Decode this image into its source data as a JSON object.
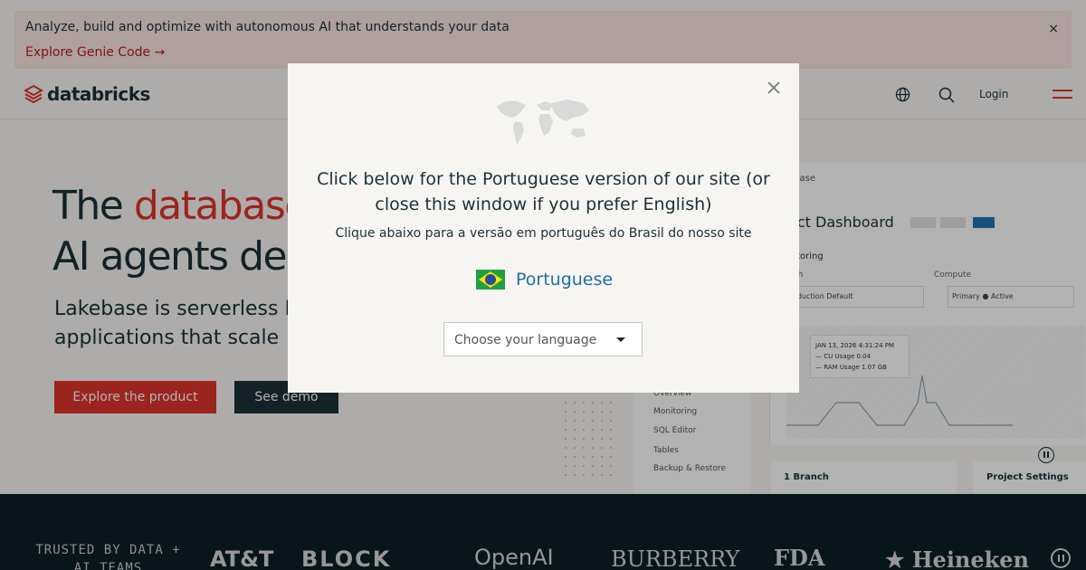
{
  "banner": {
    "text": "Analyze, build and optimize with autonomous AI that understands your data",
    "link": "Explore Genie Code →",
    "close": "×"
  },
  "nav": {
    "logo": "databricks",
    "login": "Login",
    "icons": [
      "globe-icon",
      "search-icon",
      "menu-icon"
    ]
  },
  "hero": {
    "title_line1_prefix": "The ",
    "title_line1_accent": "database",
    "title_line2": "AI agents des",
    "sub_line1": "Lakebase is serverless P",
    "sub_line2": "applications that scale",
    "primary_button": "Explore the product",
    "secondary_button": "See demo"
  },
  "dashboard": {
    "crumb": "ebase",
    "title": "ect Dashboard",
    "monitoring": "nitoring",
    "branch_label": "nch",
    "compute_label": "Compute",
    "branch_value": "oduction   Default",
    "compute_value": "Primary   ● Active",
    "tooltip_date": "JAN 13, 2026 4:31:24 PM",
    "tooltip_cu": "— CU Usage        0.04",
    "tooltip_ram": "— RAM Usage    1.07 GB",
    "side_items": [
      "Overview",
      "Monitoring",
      "SQL Editor",
      "Tables",
      "Backup & Restore"
    ],
    "branch_count": "1 Branch",
    "project_settings": "Project Settings"
  },
  "strip": {
    "label": "TRUSTED BY DATA + AI TEAMS",
    "logos": [
      "AT&T",
      "BLOCK",
      "OpenAI",
      "BURBERRY",
      "FDA",
      "★ Heineken"
    ]
  },
  "modal": {
    "heading": "Click below for the Portuguese version of our site (or close this window if you prefer English)",
    "sub": "Clique abaixo para a versão em português do Brasil do nosso site",
    "language_link": "Portuguese",
    "select_placeholder": "Choose your language",
    "colors": {
      "link": "#1d6fa5",
      "accent": "#e0342c",
      "dark": "#1b3139"
    }
  }
}
